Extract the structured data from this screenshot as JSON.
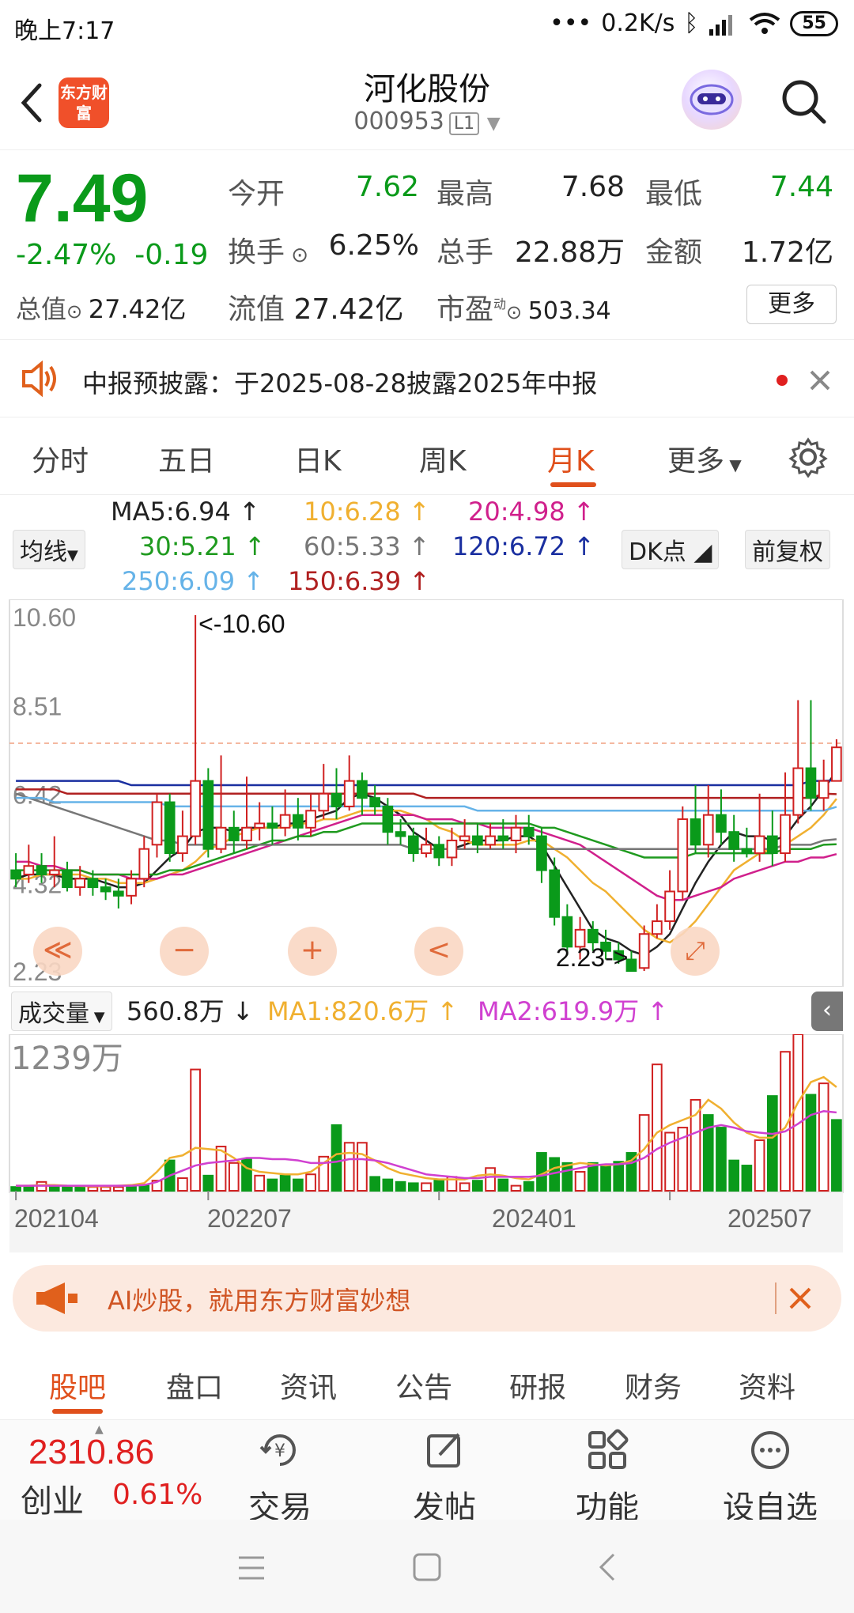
{
  "status": {
    "time": "晚上7:17",
    "net_speed": "0.2K/s",
    "battery": "55"
  },
  "header": {
    "logo_text": "东方财富",
    "title": "河化股份",
    "code": "000953",
    "level": "L1"
  },
  "quote": {
    "price": "7.49",
    "change_pct": "-2.47%",
    "change": "-0.19",
    "open": {
      "label": "今开",
      "value": "7.62"
    },
    "high": {
      "label": "最高",
      "value": "7.68"
    },
    "low": {
      "label": "最低",
      "value": "7.44"
    },
    "turnover": {
      "label": "换手",
      "value": "6.25%"
    },
    "volume": {
      "label": "总手",
      "value": "22.88万"
    },
    "amount": {
      "label": "金额",
      "value": "1.72亿"
    },
    "total_cap": {
      "label": "总值",
      "value": "27.42亿"
    },
    "float_cap": {
      "label": "流值",
      "value": "27.42亿"
    },
    "pe": {
      "label": "市盈",
      "sup": "动",
      "value": "503.34"
    },
    "more_button": "更多"
  },
  "notice": {
    "text": "中报预披露：于2025-08-28披露2025年中报"
  },
  "tabs": [
    "分时",
    "五日",
    "日K",
    "周K",
    "月K",
    "更多"
  ],
  "active_tab": "月K",
  "ma_legend": {
    "selector": "均线",
    "dk_button": "DK点",
    "adjust_button": "前复权",
    "items": [
      {
        "text": "MA5:6.94",
        "color": "#222222"
      },
      {
        "text": "10:6.28",
        "color": "#f0b030"
      },
      {
        "text": "20:4.98",
        "color": "#d0208c"
      },
      {
        "text": "30:5.21",
        "color": "#1f9a1f"
      },
      {
        "text": "60:5.33",
        "color": "#777777"
      },
      {
        "text": "120:6.72",
        "color": "#1a2fa0"
      },
      {
        "text": "250:6.09",
        "color": "#66b3e8"
      },
      {
        "text": "150:6.39",
        "color": "#b02020"
      }
    ]
  },
  "chart_data": [
    {
      "type": "candlestick",
      "y_ticks": [
        "10.60",
        "8.51",
        "6.42",
        "4.32",
        "2.23"
      ],
      "ylim": [
        2.23,
        10.6
      ],
      "max_label": "<-10.60",
      "min_label": "2.23->",
      "colors": {
        "up": "#d02020",
        "down": "#0a9a1a"
      },
      "candles": [
        [
          4.6,
          4.4,
          5.0,
          4.2
        ],
        [
          4.5,
          4.7,
          5.2,
          4.3
        ],
        [
          4.7,
          4.5,
          5.0,
          4.3
        ],
        [
          4.5,
          4.6,
          5.4,
          4.2
        ],
        [
          4.6,
          4.2,
          4.8,
          4.1
        ],
        [
          4.2,
          4.4,
          4.7,
          4.0
        ],
        [
          4.4,
          4.2,
          4.6,
          4.0
        ],
        [
          4.2,
          4.1,
          4.4,
          3.9
        ],
        [
          4.1,
          4.0,
          4.4,
          3.7
        ],
        [
          4.0,
          4.4,
          4.6,
          3.8
        ],
        [
          4.4,
          5.1,
          5.4,
          4.2
        ],
        [
          5.2,
          6.2,
          6.4,
          4.9
        ],
        [
          6.2,
          5.0,
          6.4,
          4.8
        ],
        [
          5.0,
          5.4,
          6.0,
          4.8
        ],
        [
          5.4,
          6.7,
          10.6,
          5.2
        ],
        [
          6.7,
          5.1,
          7.0,
          4.9
        ],
        [
          5.1,
          5.6,
          7.3,
          5.0
        ],
        [
          5.6,
          5.3,
          6.0,
          5.0
        ],
        [
          5.3,
          5.6,
          6.8,
          5.1
        ],
        [
          5.6,
          5.7,
          6.2,
          5.3
        ],
        [
          5.7,
          5.6,
          6.1,
          5.2
        ],
        [
          5.6,
          5.9,
          6.5,
          5.4
        ],
        [
          5.9,
          5.6,
          6.3,
          5.3
        ],
        [
          5.6,
          6.0,
          6.4,
          5.4
        ],
        [
          6.0,
          6.4,
          7.1,
          5.8
        ],
        [
          6.4,
          6.1,
          7.0,
          5.8
        ],
        [
          6.1,
          6.7,
          7.3,
          6.0
        ],
        [
          6.7,
          6.3,
          6.9,
          5.9
        ],
        [
          6.3,
          6.1,
          6.6,
          5.9
        ],
        [
          6.1,
          5.5,
          6.3,
          5.2
        ],
        [
          5.5,
          5.4,
          5.8,
          5.2
        ],
        [
          5.4,
          5.0,
          5.6,
          4.8
        ],
        [
          5.0,
          5.2,
          5.6,
          4.9
        ],
        [
          5.2,
          4.9,
          5.4,
          4.7
        ],
        [
          4.9,
          5.3,
          5.6,
          4.7
        ],
        [
          5.3,
          5.4,
          5.8,
          5.1
        ],
        [
          5.4,
          5.2,
          5.7,
          5.0
        ],
        [
          5.2,
          5.4,
          5.7,
          5.1
        ],
        [
          5.4,
          5.3,
          5.8,
          5.1
        ],
        [
          5.3,
          5.6,
          5.9,
          5.0
        ],
        [
          5.6,
          5.4,
          5.9,
          5.2
        ],
        [
          5.4,
          4.6,
          5.6,
          4.3
        ],
        [
          4.6,
          3.5,
          4.9,
          3.3
        ],
        [
          3.5,
          2.8,
          3.8,
          2.6
        ],
        [
          2.8,
          3.2,
          3.5,
          2.5
        ],
        [
          3.2,
          2.9,
          3.4,
          2.7
        ],
        [
          2.9,
          2.7,
          3.2,
          2.5
        ],
        [
          2.7,
          2.5,
          2.9,
          2.4
        ],
        [
          2.5,
          2.23,
          2.7,
          2.23
        ],
        [
          2.3,
          3.1,
          3.3,
          2.23
        ],
        [
          3.1,
          3.4,
          3.8,
          3.0
        ],
        [
          3.4,
          4.1,
          4.6,
          3.2
        ],
        [
          4.1,
          5.8,
          6.1,
          3.9
        ],
        [
          5.8,
          5.2,
          6.6,
          5.0
        ],
        [
          5.2,
          5.9,
          6.6,
          4.9
        ],
        [
          5.9,
          5.5,
          6.5,
          5.2
        ],
        [
          5.5,
          5.1,
          5.9,
          4.8
        ],
        [
          5.1,
          5.0,
          5.6,
          4.9
        ],
        [
          5.0,
          5.4,
          6.4,
          4.8
        ],
        [
          5.4,
          5.0,
          6.0,
          4.7
        ],
        [
          5.0,
          5.9,
          6.9,
          4.8
        ],
        [
          5.9,
          7.0,
          8.6,
          5.7
        ],
        [
          7.0,
          6.3,
          8.6,
          6.0
        ],
        [
          6.3,
          6.7,
          7.2,
          6.0
        ],
        [
          6.7,
          7.49,
          7.68,
          7.44
        ]
      ],
      "ma_lines": {
        "ma5": [
          4.4,
          4.5,
          4.5,
          4.5,
          4.4,
          4.4,
          4.4,
          4.3,
          4.2,
          4.2,
          4.3,
          4.6,
          4.9,
          5.1,
          5.5,
          5.6,
          5.6,
          5.5,
          5.6,
          5.6,
          5.6,
          5.7,
          5.7,
          5.8,
          5.9,
          6.0,
          6.3,
          6.4,
          6.3,
          6.1,
          5.9,
          5.5,
          5.3,
          5.1,
          5.1,
          5.2,
          5.3,
          5.3,
          5.3,
          5.4,
          5.4,
          5.2,
          4.7,
          4.2,
          3.7,
          3.2,
          3.0,
          2.9,
          2.7,
          2.6,
          2.8,
          3.1,
          3.7,
          4.3,
          4.8,
          5.2,
          5.5,
          5.4,
          5.4,
          5.3,
          5.4,
          5.8,
          6.1,
          6.5,
          6.94
        ],
        "ma10": [
          4.4,
          4.4,
          4.5,
          4.5,
          4.5,
          4.5,
          4.4,
          4.4,
          4.3,
          4.3,
          4.3,
          4.4,
          4.5,
          4.6,
          4.8,
          5.1,
          5.2,
          5.4,
          5.5,
          5.6,
          5.6,
          5.6,
          5.7,
          5.7,
          5.8,
          5.8,
          5.9,
          6.0,
          6.0,
          6.0,
          6.0,
          5.9,
          5.8,
          5.6,
          5.5,
          5.3,
          5.2,
          5.2,
          5.2,
          5.2,
          5.3,
          5.3,
          5.1,
          4.9,
          4.6,
          4.3,
          4.1,
          3.8,
          3.5,
          3.2,
          3.0,
          2.9,
          3.1,
          3.4,
          3.8,
          4.2,
          4.6,
          4.8,
          5.0,
          5.1,
          5.2,
          5.4,
          5.6,
          5.9,
          6.28
        ],
        "ma20": [
          4.8,
          4.8,
          4.7,
          4.7,
          4.6,
          4.6,
          4.5,
          4.5,
          4.5,
          4.4,
          4.4,
          4.4,
          4.5,
          4.5,
          4.6,
          4.7,
          4.8,
          4.9,
          5.0,
          5.1,
          5.2,
          5.3,
          5.4,
          5.5,
          5.6,
          5.7,
          5.8,
          5.9,
          5.9,
          5.9,
          5.9,
          5.9,
          5.8,
          5.8,
          5.8,
          5.7,
          5.7,
          5.6,
          5.6,
          5.6,
          5.6,
          5.5,
          5.4,
          5.3,
          5.2,
          5.0,
          4.8,
          4.6,
          4.4,
          4.2,
          4.0,
          3.9,
          3.9,
          4.0,
          4.1,
          4.2,
          4.4,
          4.5,
          4.6,
          4.7,
          4.8,
          4.8,
          4.9,
          4.9,
          4.98
        ],
        "ma30": [
          4.6,
          4.6,
          4.6,
          4.6,
          4.6,
          4.6,
          4.5,
          4.5,
          4.5,
          4.5,
          4.5,
          4.5,
          4.6,
          4.6,
          4.7,
          4.8,
          4.9,
          5.0,
          5.1,
          5.2,
          5.3,
          5.3,
          5.4,
          5.4,
          5.5,
          5.5,
          5.6,
          5.7,
          5.7,
          5.7,
          5.7,
          5.7,
          5.7,
          5.7,
          5.7,
          5.7,
          5.7,
          5.7,
          5.7,
          5.7,
          5.7,
          5.6,
          5.6,
          5.5,
          5.4,
          5.3,
          5.2,
          5.1,
          5.0,
          4.9,
          4.9,
          4.9,
          4.9,
          5.0,
          5.0,
          5.0,
          5.0,
          5.0,
          5.0,
          5.0,
          5.1,
          5.1,
          5.1,
          5.2,
          5.21
        ],
        "ma60": [
          6.4,
          6.3,
          6.2,
          6.1,
          6.0,
          5.9,
          5.8,
          5.7,
          5.6,
          5.5,
          5.4,
          5.3,
          5.3,
          5.2,
          5.2,
          5.2,
          5.2,
          5.2,
          5.2,
          5.2,
          5.2,
          5.2,
          5.2,
          5.2,
          5.2,
          5.2,
          5.2,
          5.2,
          5.2,
          5.2,
          5.2,
          5.1,
          5.1,
          5.1,
          5.1,
          5.1,
          5.1,
          5.1,
          5.1,
          5.1,
          5.1,
          5.1,
          5.1,
          5.1,
          5.1,
          5.1,
          5.1,
          5.1,
          5.1,
          5.1,
          5.1,
          5.1,
          5.1,
          5.1,
          5.1,
          5.1,
          5.1,
          5.1,
          5.1,
          5.1,
          5.2,
          5.2,
          5.2,
          5.3,
          5.33
        ],
        "ma120": [
          6.7,
          6.7,
          6.7,
          6.7,
          6.7,
          6.7,
          6.7,
          6.7,
          6.7,
          6.6,
          6.6,
          6.6,
          6.6,
          6.6,
          6.6,
          6.6,
          6.6,
          6.6,
          6.6,
          6.6,
          6.6,
          6.6,
          6.6,
          6.6,
          6.6,
          6.6,
          6.6,
          6.6,
          6.6,
          6.6,
          6.6,
          6.6,
          6.6,
          6.6,
          6.6,
          6.6,
          6.6,
          6.6,
          6.6,
          6.6,
          6.6,
          6.6,
          6.6,
          6.6,
          6.6,
          6.6,
          6.6,
          6.6,
          6.6,
          6.6,
          6.6,
          6.6,
          6.6,
          6.6,
          6.6,
          6.6,
          6.6,
          6.6,
          6.6,
          6.6,
          6.6,
          6.6,
          6.7,
          6.7,
          6.72
        ],
        "ma150": [
          6.5,
          6.5,
          6.5,
          6.5,
          6.4,
          6.4,
          6.4,
          6.4,
          6.4,
          6.4,
          6.4,
          6.4,
          6.4,
          6.4,
          6.4,
          6.4,
          6.4,
          6.4,
          6.4,
          6.4,
          6.4,
          6.4,
          6.4,
          6.4,
          6.4,
          6.4,
          6.4,
          6.4,
          6.4,
          6.4,
          6.4,
          6.4,
          6.3,
          6.3,
          6.3,
          6.3,
          6.3,
          6.3,
          6.3,
          6.3,
          6.3,
          6.3,
          6.3,
          6.3,
          6.3,
          6.3,
          6.3,
          6.3,
          6.3,
          6.3,
          6.3,
          6.3,
          6.3,
          6.3,
          6.3,
          6.3,
          6.3,
          6.3,
          6.3,
          6.3,
          6.3,
          6.3,
          6.3,
          6.4,
          6.39
        ],
        "ma250": [
          6.3,
          6.3,
          6.3,
          6.2,
          6.2,
          6.2,
          6.2,
          6.2,
          6.2,
          6.2,
          6.2,
          6.2,
          6.1,
          6.1,
          6.1,
          6.1,
          6.1,
          6.1,
          6.1,
          6.1,
          6.1,
          6.1,
          6.1,
          6.1,
          6.1,
          6.1,
          6.1,
          6.1,
          6.1,
          6.1,
          6.1,
          6.1,
          6.1,
          6.1,
          6.1,
          6.1,
          6.0,
          6.0,
          6.0,
          6.0,
          6.0,
          6.0,
          6.0,
          6.0,
          6.0,
          6.0,
          6.0,
          6.0,
          6.0,
          6.0,
          6.0,
          6.0,
          6.0,
          6.0,
          6.0,
          6.0,
          6.0,
          6.0,
          6.0,
          6.0,
          6.0,
          6.0,
          6.0,
          6.0,
          6.09
        ]
      }
    },
    {
      "type": "bar",
      "selector": "成交量",
      "current": "560.8万",
      "ma1": "MA1:820.6万",
      "ma2": "MA2:619.9万",
      "ma1_color": "#f0b030",
      "ma2_color": "#d040d0",
      "y_max_label": "1239万",
      "ylim": [
        0,
        1239
      ],
      "x_ticks": [
        "202104",
        "202207",
        "202401",
        "202507"
      ],
      "values": [
        30,
        40,
        70,
        40,
        30,
        30,
        30,
        30,
        30,
        40,
        40,
        80,
        240,
        100,
        960,
        120,
        350,
        220,
        250,
        120,
        90,
        120,
        90,
        130,
        270,
        520,
        380,
        380,
        110,
        90,
        70,
        60,
        60,
        90,
        110,
        60,
        80,
        180,
        90,
        40,
        70,
        300,
        260,
        220,
        150,
        220,
        200,
        230,
        300,
        600,
        1000,
        460,
        500,
        720,
        600,
        500,
        240,
        200,
        400,
        750,
        1100,
        1239,
        760,
        850,
        560.8
      ],
      "ups": [
        0,
        0,
        1,
        0,
        0,
        0,
        1,
        1,
        1,
        0,
        0,
        1,
        0,
        1,
        1,
        0,
        1,
        1,
        0,
        1,
        0,
        0,
        0,
        1,
        1,
        0,
        1,
        1,
        0,
        0,
        0,
        0,
        1,
        0,
        1,
        1,
        0,
        1,
        0,
        1,
        0,
        0,
        0,
        0,
        1,
        0,
        0,
        0,
        0,
        1,
        1,
        1,
        1,
        1,
        0,
        0,
        0,
        0,
        1,
        0,
        1,
        1,
        0,
        1,
        0
      ],
      "ma1_line": [
        40,
        40,
        45,
        45,
        40,
        38,
        35,
        35,
        40,
        45,
        60,
        150,
        260,
        280,
        340,
        330,
        320,
        260,
        180,
        150,
        140,
        130,
        130,
        150,
        220,
        290,
        300,
        290,
        240,
        180,
        140,
        120,
        100,
        90,
        90,
        90,
        120,
        130,
        120,
        100,
        90,
        130,
        180,
        200,
        220,
        210,
        200,
        210,
        240,
        330,
        460,
        520,
        560,
        600,
        720,
        650,
        540,
        460,
        420,
        420,
        500,
        700,
        860,
        900,
        820.6
      ],
      "ma2_line": [
        40,
        40,
        40,
        40,
        40,
        40,
        40,
        40,
        40,
        40,
        45,
        70,
        120,
        160,
        200,
        220,
        230,
        240,
        260,
        260,
        250,
        250,
        240,
        220,
        220,
        230,
        250,
        250,
        240,
        220,
        190,
        160,
        130,
        120,
        110,
        100,
        100,
        110,
        110,
        110,
        110,
        120,
        140,
        160,
        180,
        200,
        210,
        210,
        220,
        260,
        330,
        380,
        420,
        460,
        500,
        520,
        500,
        470,
        460,
        450,
        470,
        530,
        600,
        630,
        619.9
      ]
    }
  ],
  "float_buttons": [
    "≪",
    "−",
    "+",
    "<",
    "⤢"
  ],
  "ad": {
    "text": "AI炒股，就用东方财富妙想"
  },
  "bottom_tabs": [
    "股吧",
    "盘口",
    "资讯",
    "公告",
    "研报",
    "财务",
    "资料"
  ],
  "dock": {
    "index_value": "2310.86",
    "index_name": "创业",
    "index_change": "0.61%",
    "items": [
      {
        "label": "交易",
        "icon": "trade-icon"
      },
      {
        "label": "发帖",
        "icon": "post-icon"
      },
      {
        "label": "功能",
        "icon": "apps-icon"
      },
      {
        "label": "设自选",
        "icon": "more-icon"
      }
    ]
  }
}
